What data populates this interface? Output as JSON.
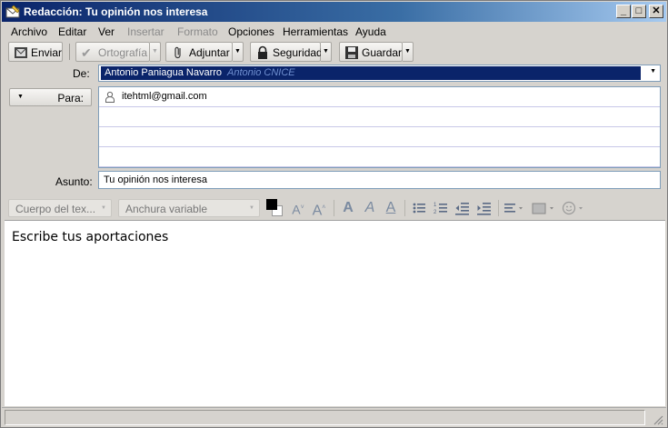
{
  "window": {
    "title": "Redacción: Tu opinión nos interesa",
    "controls": {
      "minimize": "_",
      "maximize": "□",
      "close": "✕"
    }
  },
  "menu": [
    "Archivo",
    "Editar",
    "Ver",
    "Insertar",
    "Formato",
    "Opciones",
    "Herramientas",
    "Ayuda"
  ],
  "toolbar": {
    "send": "Enviar",
    "spelling": "Ortografía",
    "attach": "Adjuntar",
    "security": "Seguridad",
    "save": "Guardar"
  },
  "headers": {
    "from_label": "De:",
    "from_value": "Antonio Paniagua Navarro",
    "from_secondary": "Antonio CNICE",
    "to_label": "Para:",
    "recipients": [
      "itehtml@gmail.com",
      "",
      "",
      ""
    ],
    "subject_label": "Asunto:",
    "subject_value": "Tu opinión nos interesa"
  },
  "format_bar": {
    "paragraph_style": "Cuerpo del tex...",
    "font": "Anchura variable"
  },
  "body": {
    "text": "Escribe tus aportaciones"
  },
  "colors": {
    "title_bar": "#0a246a",
    "selection": "#0a246a"
  }
}
